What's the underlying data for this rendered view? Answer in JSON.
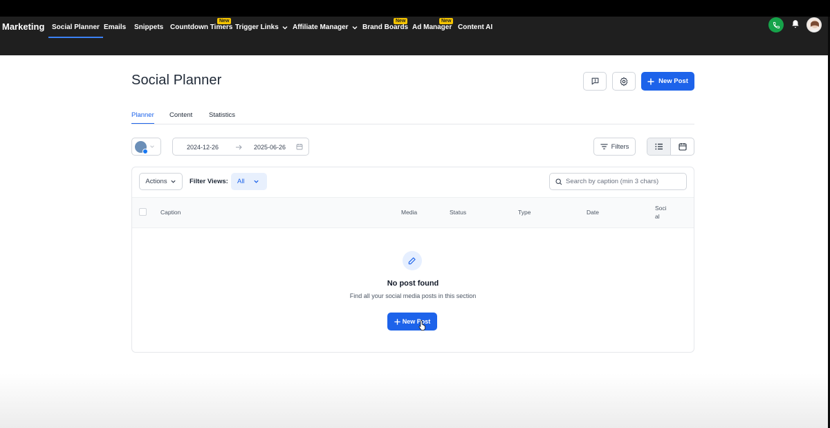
{
  "nav": {
    "brand": "Marketing",
    "items": [
      {
        "label": "Social Planner",
        "active": true
      },
      {
        "label": "Emails"
      },
      {
        "label": "Snippets"
      },
      {
        "label": "Countdown Timers",
        "badge": "New"
      },
      {
        "label": "Trigger Links",
        "dropdown": true
      },
      {
        "label": "Affiliate Manager",
        "dropdown": true
      },
      {
        "label": "Brand Boards",
        "badge": "New"
      },
      {
        "label": "Ad Manager",
        "badge": "New"
      },
      {
        "label": "Content AI"
      }
    ]
  },
  "header": {
    "title": "Social Planner",
    "new_post_label": "New Post"
  },
  "tabs": [
    {
      "label": "Planner",
      "active": true
    },
    {
      "label": "Content"
    },
    {
      "label": "Statistics"
    }
  ],
  "toolbar": {
    "date_start": "2024-12-26",
    "date_end": "2025-06-26",
    "filters_label": "Filters"
  },
  "table": {
    "actions_label": "Actions",
    "filter_views_label": "Filter Views:",
    "filter_view_value": "All",
    "search_placeholder": "Search by caption (min 3 chars)",
    "columns": [
      "Caption",
      "Media",
      "Status",
      "Type",
      "Date",
      "Soci",
      "al"
    ]
  },
  "empty": {
    "title": "No post found",
    "subtitle": "Find all your social media posts in this section",
    "button_label": "New Post"
  },
  "colors": {
    "primary": "#1d63ea",
    "nav_bg": "#1f1f1f",
    "badge": "#f5c400",
    "phone": "#16a34a"
  },
  "icons": [
    "phone-icon",
    "bell-icon",
    "feedback-icon",
    "gear-icon",
    "plus-icon",
    "calendar-icon",
    "filter-icon",
    "list-icon",
    "edit-icon",
    "chevron-down-icon",
    "search-icon",
    "arrow-right-icon",
    "cursor-icon"
  ]
}
